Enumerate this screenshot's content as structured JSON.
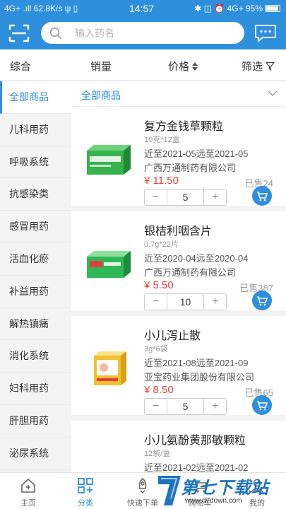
{
  "status_bar": {
    "left": "4G+ .ıll 62.8K/s ψ ▯",
    "time": "14:57",
    "right": "✱ ◫ ⏰ 4G+ 95%"
  },
  "search": {
    "placeholder": "输入药名"
  },
  "sort_bar": {
    "comprehensive": "综合",
    "sales": "销量",
    "price": "价格",
    "filter": "筛选"
  },
  "sidebar": {
    "items": [
      {
        "label": "全部商品"
      },
      {
        "label": "儿科用药"
      },
      {
        "label": "呼吸系统"
      },
      {
        "label": "抗感染类"
      },
      {
        "label": "感冒用药"
      },
      {
        "label": "活血化瘀"
      },
      {
        "label": "补益用药"
      },
      {
        "label": "解热镇痛"
      },
      {
        "label": "消化系统"
      },
      {
        "label": "妇科用药"
      },
      {
        "label": "肝胆用药"
      },
      {
        "label": "泌尿系统"
      }
    ]
  },
  "content": {
    "category_title": "全部商品",
    "products": [
      {
        "name": "复方金钱草颗粒",
        "spec": "10克*12盒",
        "expiry": "近至2021-05远至2021-05",
        "maker": "广西万通制药有限公司",
        "price": "¥ 11.50",
        "sold": "已售24",
        "qty": "5",
        "box_color": "#37b24d"
      },
      {
        "name": "银桔利咽含片",
        "spec": "0.7g*22片",
        "expiry": "近至2020-04远至2020-04",
        "maker": "广西万通制药有限公司",
        "price": "¥ 5.50",
        "sold": "已售387",
        "qty": "10",
        "box_color": "#2fb857"
      },
      {
        "name": "小儿泻止散",
        "spec": "3g*6袋",
        "expiry": "近至2021-08远至2021-09",
        "maker": "亚宝药业集团股份有限公司",
        "price": "¥ 8.50",
        "sold": "已售65",
        "qty": "5",
        "box_color": "#f2c12e"
      },
      {
        "name": "小儿氨酚黄那敏颗粒",
        "spec": "12袋/盒",
        "expiry": "近至2021-02远至2021-02",
        "maker": "",
        "price": "",
        "sold": "",
        "qty": "",
        "box_color": "#f0a020"
      }
    ]
  },
  "tabbar": {
    "tabs": [
      {
        "label": "主页"
      },
      {
        "label": "分类"
      },
      {
        "label": "快速下单"
      },
      {
        "label": "购物车"
      },
      {
        "label": "我的"
      }
    ]
  },
  "watermark": {
    "title": "第七下载站",
    "url": "www.d7down.com"
  },
  "colors": {
    "accent": "#2e8fdc",
    "price": "#e64340"
  }
}
